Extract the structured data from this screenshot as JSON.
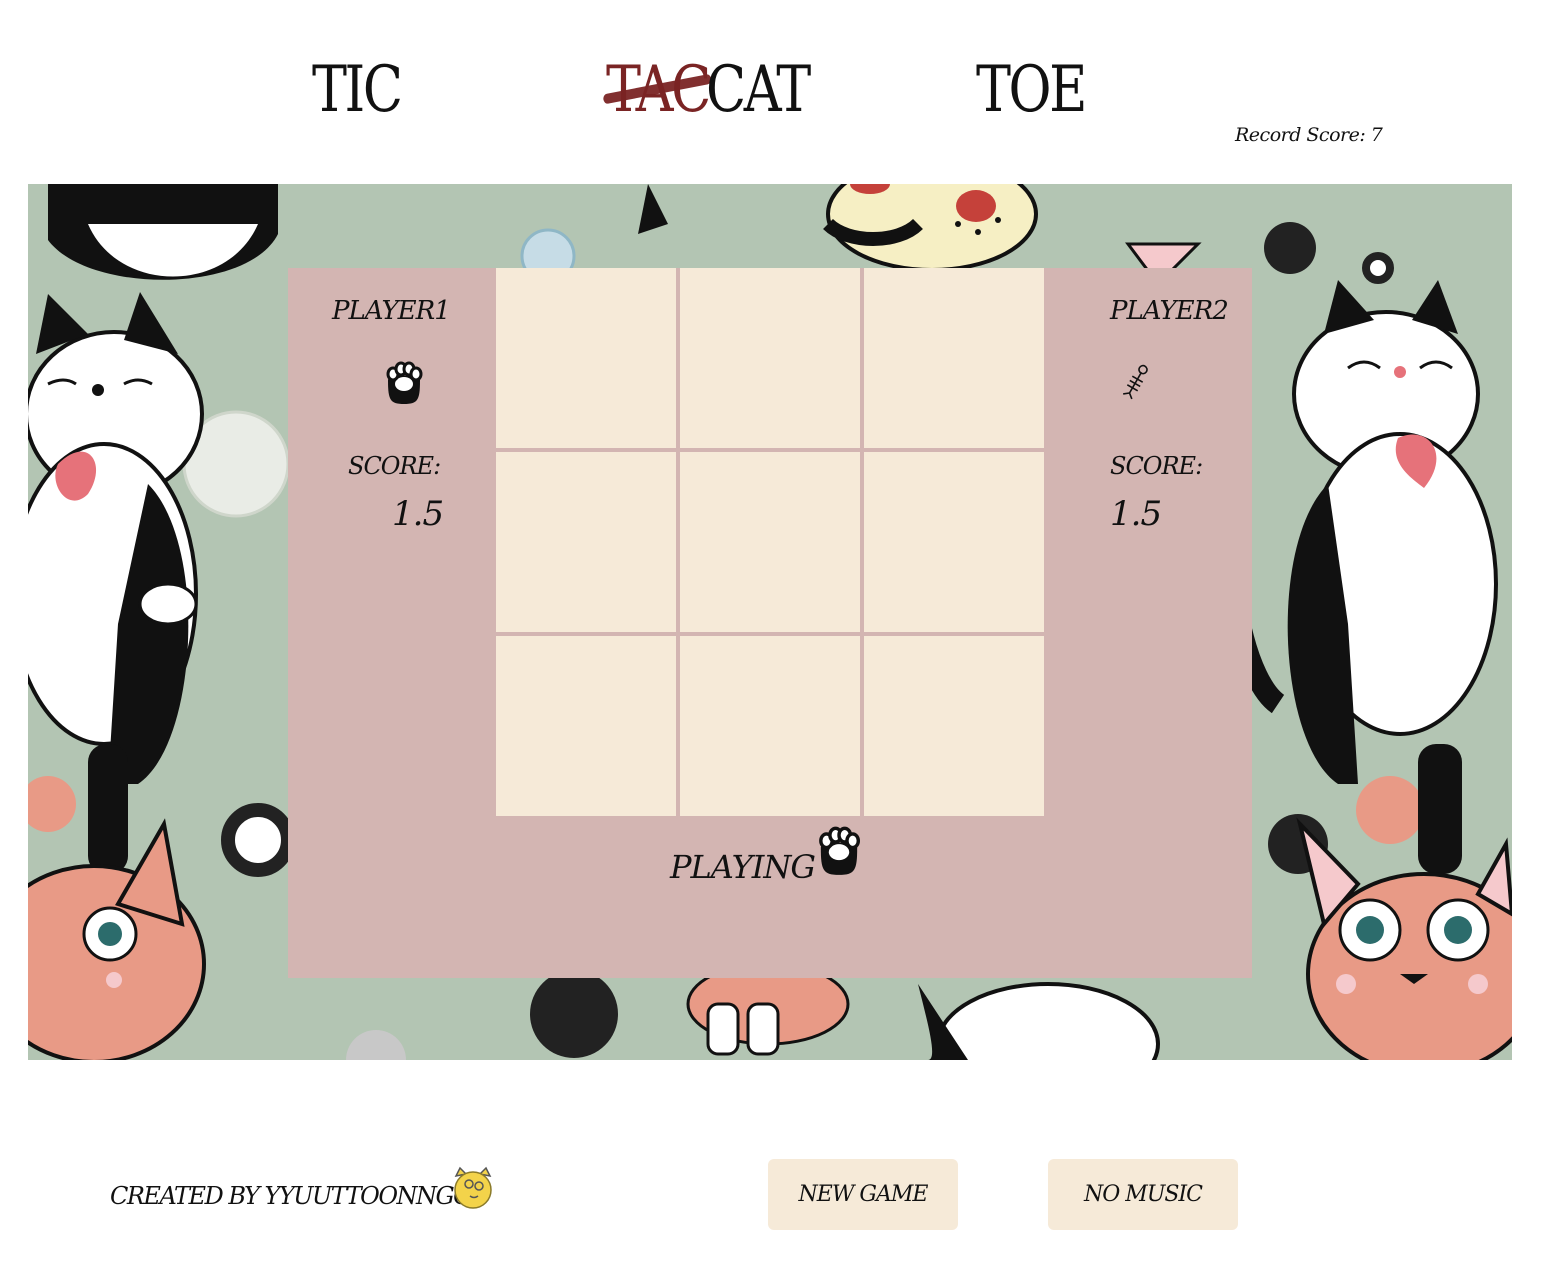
{
  "title": {
    "tic": "TIC",
    "tac": "TAC",
    "cat": "CAT",
    "toe": "TOE"
  },
  "record": {
    "text": "Record Score: 7"
  },
  "players": {
    "p1": {
      "name": "player1",
      "score_label": "score:",
      "score": "1.5",
      "icon": "paw-icon"
    },
    "p2": {
      "name": "player2",
      "score_label": "score:",
      "score": "1.5",
      "icon": "fish-bone-icon"
    }
  },
  "board": {
    "cells": [
      "",
      "",
      "",
      "",
      "",
      "",
      "",
      "",
      ""
    ]
  },
  "status": {
    "label": "playing",
    "current_icon": "paw-icon"
  },
  "footer": {
    "credit": "created by yyuuttoonngg",
    "new_game": "new game",
    "no_music": "no music"
  },
  "colors": {
    "panel": "#d3b5b2",
    "cell": "#f6ead8",
    "background": "#b3c5b3",
    "strike": "#7a2424"
  }
}
